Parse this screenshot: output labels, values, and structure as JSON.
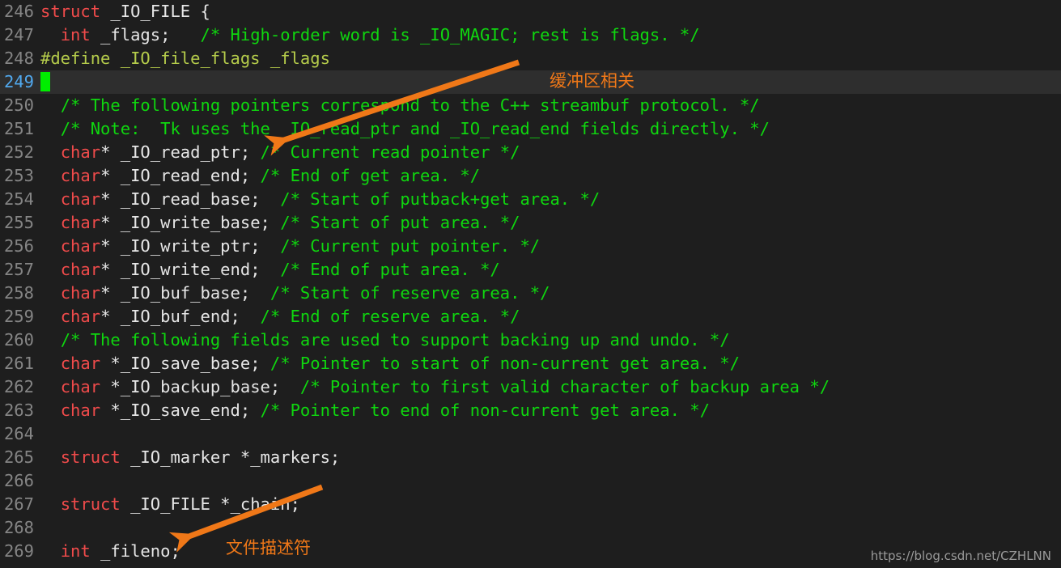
{
  "editor": {
    "background": "#1e1e1e",
    "active_line_background": "#2e2e2e",
    "line_number_color": "#858585",
    "active_line_number_color": "#51a9ee",
    "cursor_color": "#00ee00",
    "first_line_number": 246,
    "active_line_number": 249,
    "colors": {
      "keyword": "#f04b4b",
      "preprocessor": "#b5cc4b",
      "identifier": "#e6e6e6",
      "comment": "#0fd70f",
      "annotation": "#f07818",
      "watermark": "#9a9a9a"
    },
    "lines": [
      {
        "num": "246",
        "active": false,
        "tokens": [
          {
            "t": "struct ",
            "c": "kw"
          },
          {
            "t": "_IO_FILE {",
            "c": "id"
          }
        ]
      },
      {
        "num": "247",
        "active": false,
        "tokens": [
          {
            "t": "  ",
            "c": "id"
          },
          {
            "t": "int",
            "c": "kw"
          },
          {
            "t": " _flags;   ",
            "c": "id"
          },
          {
            "t": "/* High-order word is _IO_MAGIC; rest is flags. */",
            "c": "cmt"
          }
        ]
      },
      {
        "num": "248",
        "active": false,
        "tokens": [
          {
            "t": "#define _IO_file_flags _flags",
            "c": "pp"
          }
        ]
      },
      {
        "num": "249",
        "active": true,
        "tokens": []
      },
      {
        "num": "250",
        "active": false,
        "tokens": [
          {
            "t": "  ",
            "c": "id"
          },
          {
            "t": "/* The following pointers correspond to the C++ streambuf protocol. */",
            "c": "cmt"
          }
        ]
      },
      {
        "num": "251",
        "active": false,
        "tokens": [
          {
            "t": "  ",
            "c": "id"
          },
          {
            "t": "/* Note:  Tk uses the _IO_read_ptr and _IO_read_end fields directly. */",
            "c": "cmt"
          }
        ]
      },
      {
        "num": "252",
        "active": false,
        "tokens": [
          {
            "t": "  ",
            "c": "id"
          },
          {
            "t": "char",
            "c": "kw"
          },
          {
            "t": "* _IO_read_ptr; ",
            "c": "id"
          },
          {
            "t": "/* Current read pointer */",
            "c": "cmt"
          }
        ]
      },
      {
        "num": "253",
        "active": false,
        "tokens": [
          {
            "t": "  ",
            "c": "id"
          },
          {
            "t": "char",
            "c": "kw"
          },
          {
            "t": "* _IO_read_end; ",
            "c": "id"
          },
          {
            "t": "/* End of get area. */",
            "c": "cmt"
          }
        ]
      },
      {
        "num": "254",
        "active": false,
        "tokens": [
          {
            "t": "  ",
            "c": "id"
          },
          {
            "t": "char",
            "c": "kw"
          },
          {
            "t": "* _IO_read_base;  ",
            "c": "id"
          },
          {
            "t": "/* Start of putback+get area. */",
            "c": "cmt"
          }
        ]
      },
      {
        "num": "255",
        "active": false,
        "tokens": [
          {
            "t": "  ",
            "c": "id"
          },
          {
            "t": "char",
            "c": "kw"
          },
          {
            "t": "* _IO_write_base; ",
            "c": "id"
          },
          {
            "t": "/* Start of put area. */",
            "c": "cmt"
          }
        ]
      },
      {
        "num": "256",
        "active": false,
        "tokens": [
          {
            "t": "  ",
            "c": "id"
          },
          {
            "t": "char",
            "c": "kw"
          },
          {
            "t": "* _IO_write_ptr;  ",
            "c": "id"
          },
          {
            "t": "/* Current put pointer. */",
            "c": "cmt"
          }
        ]
      },
      {
        "num": "257",
        "active": false,
        "tokens": [
          {
            "t": "  ",
            "c": "id"
          },
          {
            "t": "char",
            "c": "kw"
          },
          {
            "t": "* _IO_write_end;  ",
            "c": "id"
          },
          {
            "t": "/* End of put area. */",
            "c": "cmt"
          }
        ]
      },
      {
        "num": "258",
        "active": false,
        "tokens": [
          {
            "t": "  ",
            "c": "id"
          },
          {
            "t": "char",
            "c": "kw"
          },
          {
            "t": "* _IO_buf_base;  ",
            "c": "id"
          },
          {
            "t": "/* Start of reserve area. */",
            "c": "cmt"
          }
        ]
      },
      {
        "num": "259",
        "active": false,
        "tokens": [
          {
            "t": "  ",
            "c": "id"
          },
          {
            "t": "char",
            "c": "kw"
          },
          {
            "t": "* _IO_buf_end;  ",
            "c": "id"
          },
          {
            "t": "/* End of reserve area. */",
            "c": "cmt"
          }
        ]
      },
      {
        "num": "260",
        "active": false,
        "tokens": [
          {
            "t": "  ",
            "c": "id"
          },
          {
            "t": "/* The following fields are used to support backing up and undo. */",
            "c": "cmt"
          }
        ]
      },
      {
        "num": "261",
        "active": false,
        "tokens": [
          {
            "t": "  ",
            "c": "id"
          },
          {
            "t": "char",
            "c": "kw"
          },
          {
            "t": " *_IO_save_base; ",
            "c": "id"
          },
          {
            "t": "/* Pointer to start of non-current get area. */",
            "c": "cmt"
          }
        ]
      },
      {
        "num": "262",
        "active": false,
        "tokens": [
          {
            "t": "  ",
            "c": "id"
          },
          {
            "t": "char",
            "c": "kw"
          },
          {
            "t": " *_IO_backup_base;  ",
            "c": "id"
          },
          {
            "t": "/* Pointer to first valid character of backup area */",
            "c": "cmt"
          }
        ]
      },
      {
        "num": "263",
        "active": false,
        "tokens": [
          {
            "t": "  ",
            "c": "id"
          },
          {
            "t": "char",
            "c": "kw"
          },
          {
            "t": " *_IO_save_end; ",
            "c": "id"
          },
          {
            "t": "/* Pointer to end of non-current get area. */",
            "c": "cmt"
          }
        ]
      },
      {
        "num": "264",
        "active": false,
        "tokens": []
      },
      {
        "num": "265",
        "active": false,
        "tokens": [
          {
            "t": "  ",
            "c": "id"
          },
          {
            "t": "struct",
            "c": "kw"
          },
          {
            "t": " _IO_marker *_markers;",
            "c": "id"
          }
        ]
      },
      {
        "num": "266",
        "active": false,
        "tokens": []
      },
      {
        "num": "267",
        "active": false,
        "tokens": [
          {
            "t": "  ",
            "c": "id"
          },
          {
            "t": "struct",
            "c": "kw"
          },
          {
            "t": " _IO_FILE *_chain;",
            "c": "id"
          }
        ]
      },
      {
        "num": "268",
        "active": false,
        "tokens": []
      },
      {
        "num": "269",
        "active": false,
        "tokens": [
          {
            "t": "  ",
            "c": "id"
          },
          {
            "t": "int",
            "c": "kw"
          },
          {
            "t": " _fileno;",
            "c": "id"
          }
        ]
      }
    ]
  },
  "annotations": [
    {
      "id": "anno-buffer",
      "label": "缓冲区相关"
    },
    {
      "id": "anno-fileno",
      "label": "文件描述符"
    }
  ],
  "watermark": {
    "text": "https://blog.csdn.net/CZHLNN"
  }
}
